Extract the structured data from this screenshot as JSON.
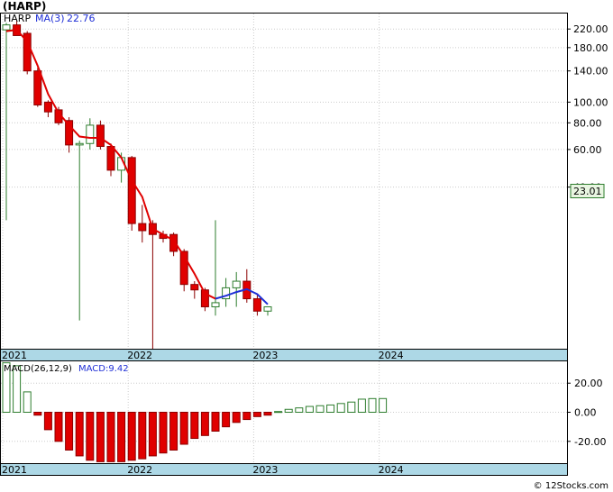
{
  "header": {
    "symbol_label": "(HARP)"
  },
  "colors": {
    "up": "#2e7d2e",
    "down": "#e00000",
    "ma_down": "#e00000",
    "ma_up": "#1f2fd6",
    "axis_band": "#add8e6",
    "grid": "#cccccc",
    "price_box": "#e8f5e1"
  },
  "chart_data": [
    {
      "type": "candlestick",
      "legend": {
        "ticker": "HARP",
        "ma_label": "MA(3)",
        "ma_value": "22.76"
      },
      "price_tag": "23.01",
      "yscale": "log",
      "ylim": [
        7,
        260
      ],
      "yticks": [
        {
          "v": 220,
          "label": "220.00"
        },
        {
          "v": 180,
          "label": "180.00"
        },
        {
          "v": 140,
          "label": "140.00"
        },
        {
          "v": 100,
          "label": "100.00"
        },
        {
          "v": 80,
          "label": "80.00"
        },
        {
          "v": 60,
          "label": "60.00"
        },
        {
          "v": 40,
          "label": "40.00"
        }
      ],
      "grid": true,
      "xticks": [
        {
          "i": 0,
          "label": "2021"
        },
        {
          "i": 12,
          "label": "2022"
        },
        {
          "i": 24,
          "label": "2023"
        },
        {
          "i": 36,
          "label": "2024"
        }
      ],
      "candles": [
        {
          "o": 218,
          "h": 235,
          "l": 28,
          "c": 230
        },
        {
          "o": 230,
          "h": 240,
          "l": 210,
          "c": 205
        },
        {
          "o": 210,
          "h": 215,
          "l": 135,
          "c": 140
        },
        {
          "o": 140,
          "h": 145,
          "l": 95,
          "c": 97
        },
        {
          "o": 100,
          "h": 102,
          "l": 85,
          "c": 90
        },
        {
          "o": 92,
          "h": 95,
          "l": 78,
          "c": 80
        },
        {
          "o": 82,
          "h": 85,
          "l": 58,
          "c": 63
        },
        {
          "o": 63,
          "h": 66,
          "l": 9.5,
          "c": 64
        },
        {
          "o": 64,
          "h": 84,
          "l": 60,
          "c": 78
        },
        {
          "o": 78,
          "h": 82,
          "l": 60,
          "c": 62
        },
        {
          "o": 62,
          "h": 64,
          "l": 45,
          "c": 48
        },
        {
          "o": 48,
          "h": 58,
          "l": 42,
          "c": 55
        },
        {
          "o": 55,
          "h": 56,
          "l": 25,
          "c": 27
        },
        {
          "o": 27,
          "h": 33,
          "l": 22,
          "c": 25
        },
        {
          "o": 27,
          "h": 28,
          "l": 6.8,
          "c": 24
        },
        {
          "o": 24,
          "h": 25,
          "l": 22,
          "c": 23
        },
        {
          "o": 24,
          "h": 24.5,
          "l": 19,
          "c": 20
        },
        {
          "o": 20,
          "h": 20.5,
          "l": 13,
          "c": 14
        },
        {
          "o": 14,
          "h": 14.5,
          "l": 12,
          "c": 13.2
        },
        {
          "o": 13.2,
          "h": 13.5,
          "l": 10.5,
          "c": 11
        },
        {
          "o": 11,
          "h": 28,
          "l": 10,
          "c": 11.5
        },
        {
          "o": 12,
          "h": 15,
          "l": 11,
          "c": 13.5
        },
        {
          "o": 13.5,
          "h": 16,
          "l": 11,
          "c": 14.5
        },
        {
          "o": 14.5,
          "h": 16.5,
          "l": 11.5,
          "c": 12
        },
        {
          "o": 12,
          "h": 12.5,
          "l": 10,
          "c": 10.5
        },
        {
          "o": 10.5,
          "h": 11,
          "l": 10,
          "c": 11
        }
      ],
      "ma": [
        215,
        218,
        192,
        148,
        109,
        89,
        78,
        69,
        68,
        68,
        63,
        55,
        43,
        36,
        25.5,
        24,
        22.5,
        19,
        15.7,
        12.7,
        12,
        12.4,
        12.9,
        13.3,
        12.6,
        11.3
      ],
      "ma_up_from": 21
    },
    {
      "type": "macd_bar",
      "legend": {
        "params": "MACD(26,12,9)",
        "value_label": "MACD:9.42"
      },
      "yticks": [
        {
          "v": 20,
          "label": "20.00"
        },
        {
          "v": 0,
          "label": "0.00"
        },
        {
          "v": -20,
          "label": "-20.00"
        }
      ],
      "ylim": [
        -35,
        35
      ],
      "xticks": [
        {
          "i": 0,
          "label": "2021"
        },
        {
          "i": 12,
          "label": "2022"
        },
        {
          "i": 24,
          "label": "2023"
        },
        {
          "i": 36,
          "label": "2024"
        }
      ],
      "values": [
        34,
        32,
        14,
        -2,
        -12,
        -20,
        -26,
        -30,
        -33,
        -34,
        -34,
        -34,
        -33,
        -32,
        -30,
        -28,
        -26,
        -22,
        -18,
        -16,
        -13,
        -10,
        -7,
        -5,
        -3,
        -2,
        0.5,
        2,
        3,
        4,
        4.5,
        5,
        6,
        7,
        9,
        9.4,
        9.42
      ]
    }
  ],
  "footer": {
    "copyright": "© 12Stocks.com"
  }
}
